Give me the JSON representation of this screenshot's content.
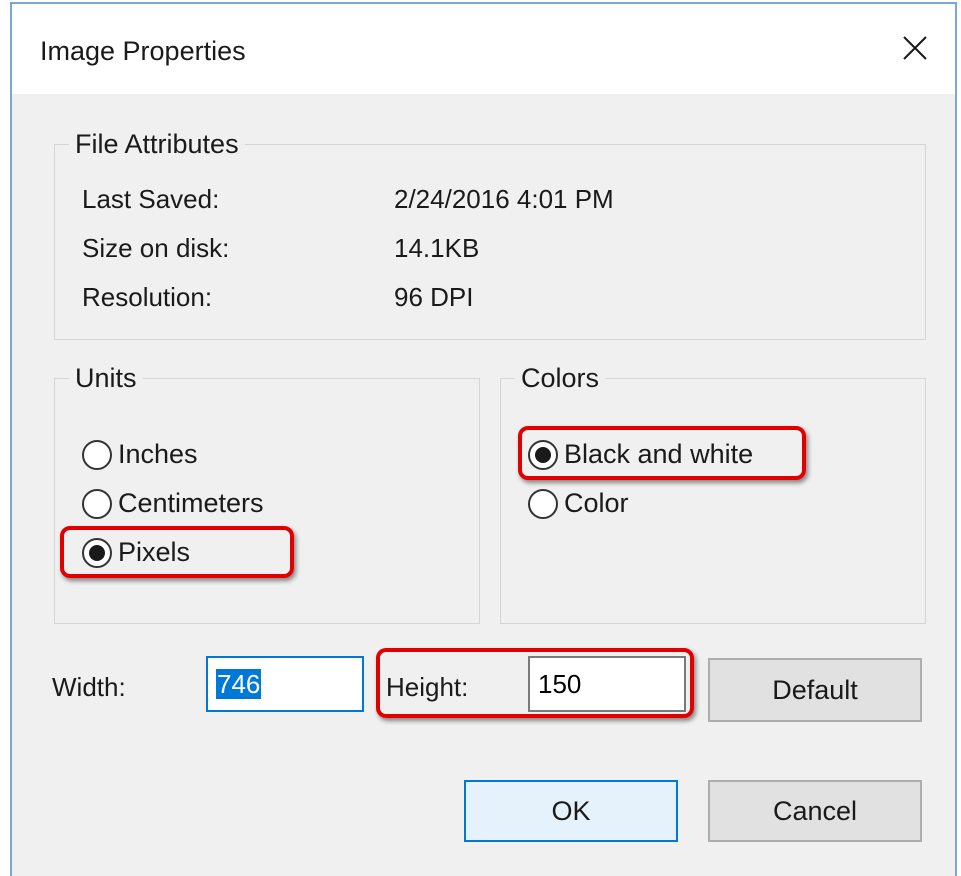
{
  "dialog": {
    "title": "Image Properties"
  },
  "file_attributes": {
    "legend": "File Attributes",
    "rows": [
      {
        "label": "Last Saved:",
        "value": "2/24/2016 4:01 PM"
      },
      {
        "label": "Size on disk:",
        "value": "14.1KB"
      },
      {
        "label": "Resolution:",
        "value": "96 DPI"
      }
    ]
  },
  "units": {
    "legend": "Units",
    "options": [
      "Inches",
      "Centimeters",
      "Pixels"
    ],
    "selected": "Pixels"
  },
  "colors": {
    "legend": "Colors",
    "options": [
      "Black and white",
      "Color"
    ],
    "selected": "Black and white"
  },
  "dimensions": {
    "width_label": "Width:",
    "width_value": "746",
    "height_label": "Height:",
    "height_value": "150"
  },
  "buttons": {
    "default_label": "Default",
    "ok_label": "OK",
    "cancel_label": "Cancel"
  },
  "icons": {
    "close": "close-icon",
    "radio": "radio-icon"
  },
  "colors_ui": {
    "highlight": "#e00000",
    "focus": "#0078d7"
  }
}
